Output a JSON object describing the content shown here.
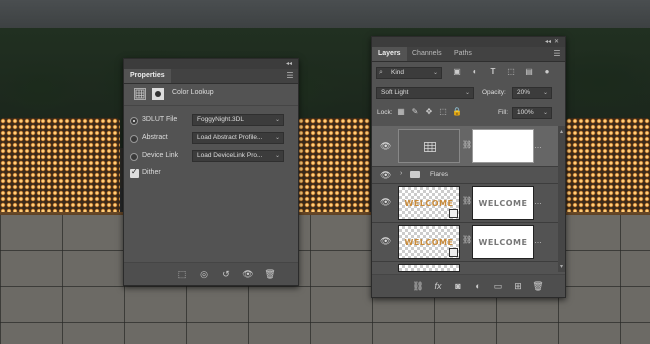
{
  "properties": {
    "tab": "Properties",
    "adjustment_title": "Color Lookup",
    "options": [
      {
        "label": "3DLUT File",
        "selected": true,
        "value": "FoggyNight.3DL"
      },
      {
        "label": "Abstract",
        "selected": false,
        "value": "Load Abstract Profile..."
      },
      {
        "label": "Device Link",
        "selected": false,
        "value": "Load DeviceLink Pro..."
      }
    ],
    "dither_label": "Dither",
    "dither_checked": true
  },
  "layers": {
    "tabs": [
      "Layers",
      "Channels",
      "Paths"
    ],
    "filter_kind": "Kind",
    "blend_mode": "Soft Light",
    "opacity_label": "Opacity:",
    "opacity_value": "20%",
    "lock_label": "Lock:",
    "fill_label": "Fill:",
    "fill_value": "100%",
    "group_name": "Flares",
    "layer_text": "WELCOME"
  },
  "colors": {
    "panel_bg": "#535353",
    "welcome_orange": "#c98b3a",
    "welcome_gray": "#777777"
  }
}
